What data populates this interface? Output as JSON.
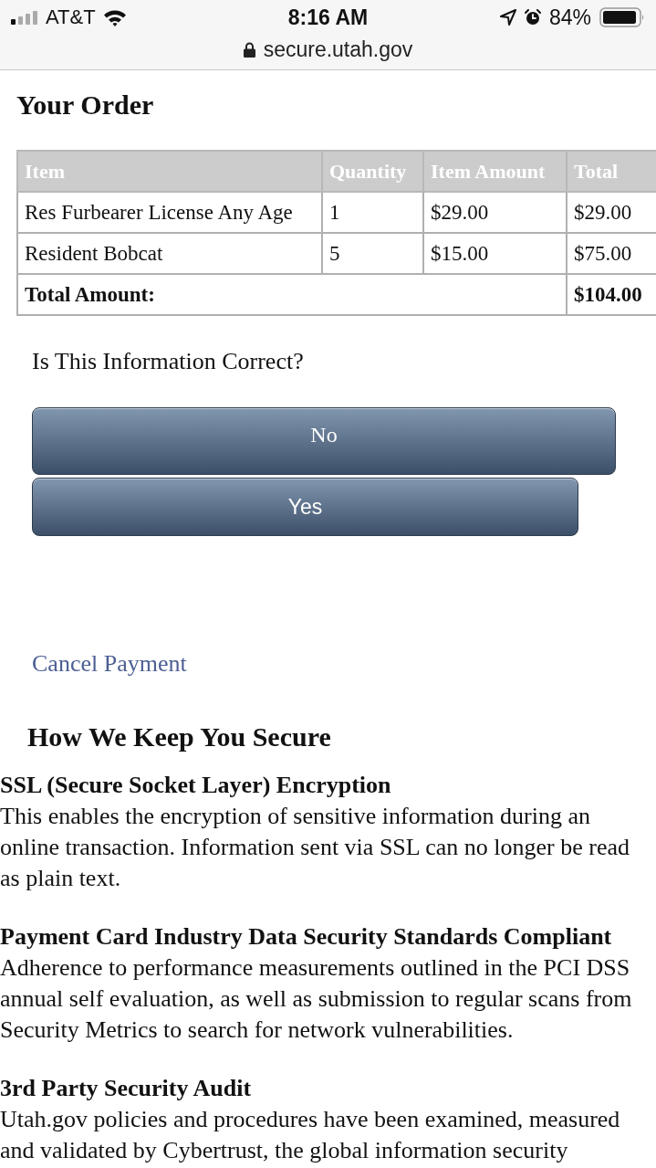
{
  "status_bar": {
    "carrier": "AT&T",
    "time": "8:16 AM",
    "battery": "84%"
  },
  "address_bar": {
    "url": "secure.utah.gov"
  },
  "order": {
    "title": "Your Order",
    "table": {
      "columns": [
        "Item",
        "Quantity",
        "Item Amount",
        "Total"
      ],
      "rows": [
        [
          "Res Furbearer License Any Age",
          "1",
          "$29.00",
          "$29.00"
        ],
        [
          "Resident Bobcat",
          "5",
          "$15.00",
          "$75.00"
        ]
      ],
      "total": {
        "label": "Total Amount:",
        "value": "$104.00"
      }
    }
  },
  "confirm": {
    "question": "Is This Information Correct?",
    "buttons": [
      "No",
      "Yes"
    ]
  },
  "cancel_link": "Cancel Payment",
  "security": {
    "title": "How We Keep You Secure",
    "sections": [
      {
        "heading": "SSL (Secure Socket Layer) Encryption",
        "text": "This enables the encryption of sensitive information during an online transaction. Information sent via SSL can no longer be read as plain text."
      },
      {
        "heading": "Payment Card Industry Data Security Standards Compliant",
        "text": "Adherence to performance measurements outlined in the PCI DSS annual self evaluation, as well as submission to regular scans from Security Metrics to search for network vulnerabilities."
      },
      {
        "heading": "3rd Party Security Audit",
        "text": "Utah.gov policies and procedures have been examined, measured and validated by Cybertrust, the global information security"
      }
    ]
  }
}
